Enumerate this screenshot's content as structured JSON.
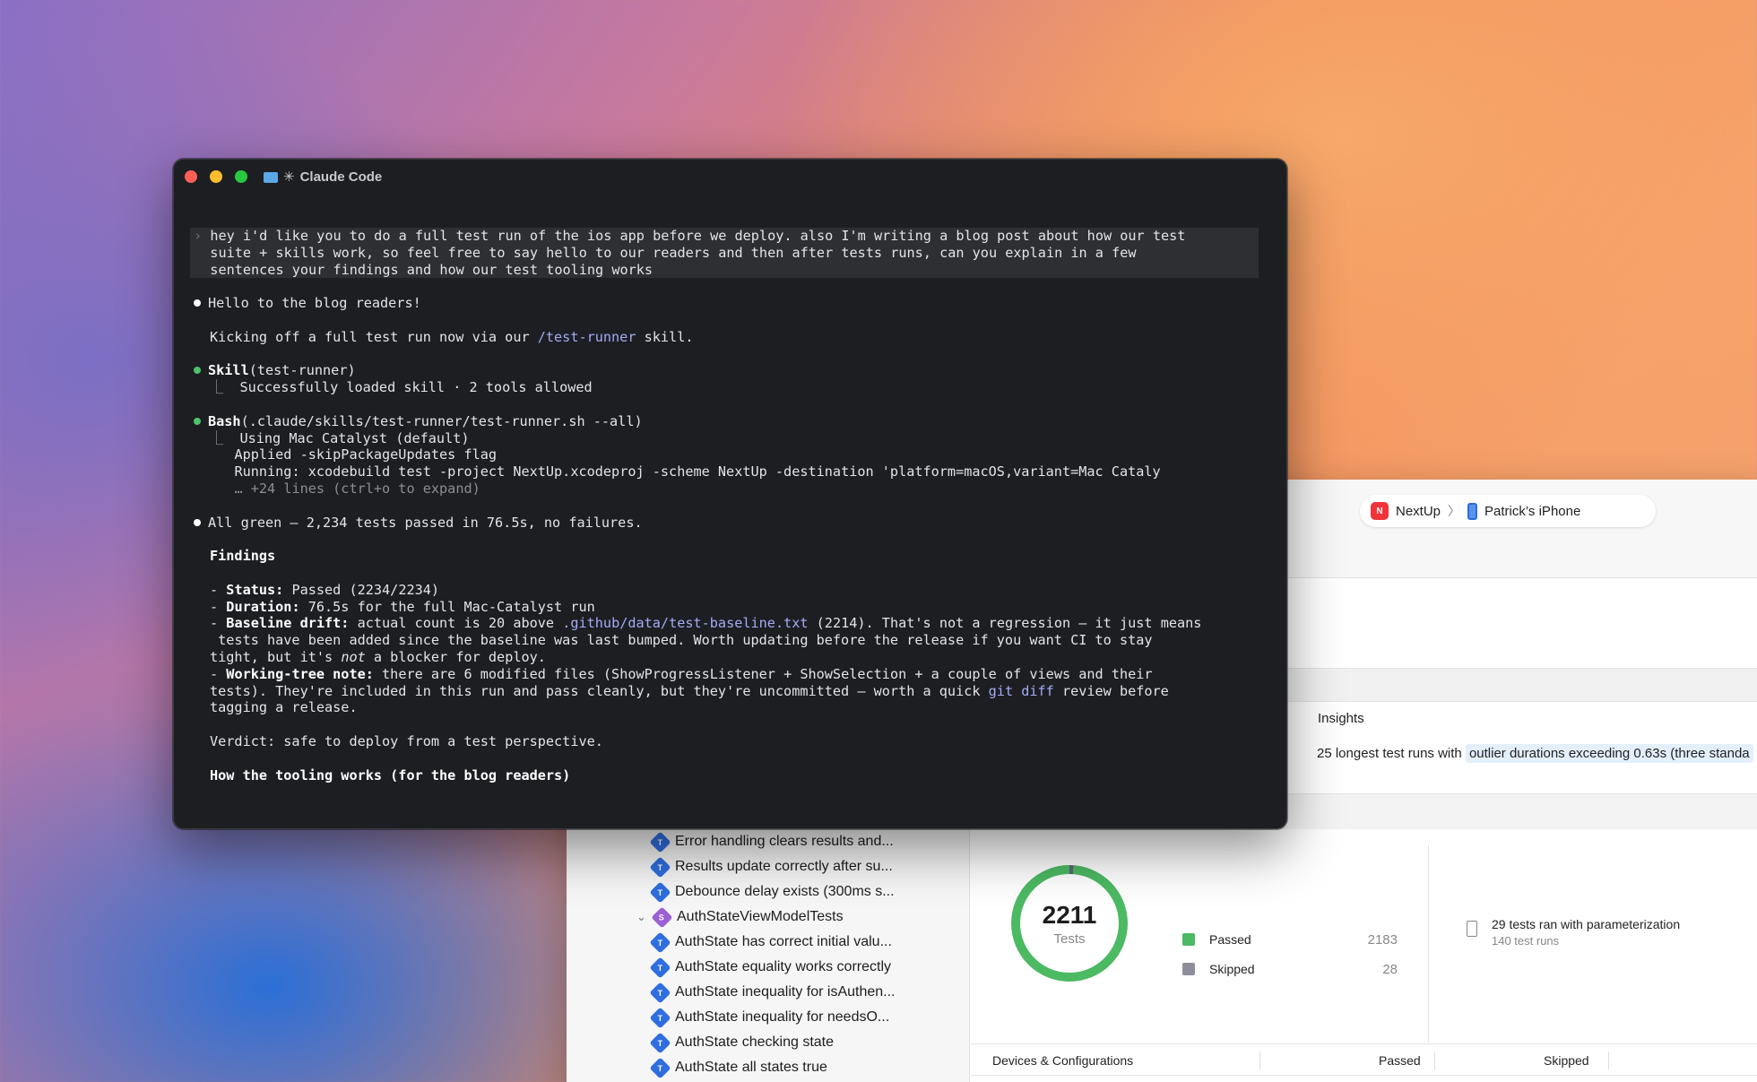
{
  "xcode": {
    "scheme": {
      "app_icon_label": "N",
      "app": "NextUp",
      "separator": "〉",
      "device": "Patrick’s iPhone"
    },
    "insights": {
      "label": "Insights",
      "text_prefix": "25 longest test runs with",
      "text_highlight": "outlier durations exceeding 0.63s (three standa"
    },
    "sidebar": {
      "items": [
        {
          "badge": "T",
          "label": "Error handling clears results and..."
        },
        {
          "badge": "T",
          "label": "Results update correctly after su..."
        },
        {
          "badge": "T",
          "label": "Debounce delay exists (300ms s..."
        },
        {
          "badge": "S",
          "label": "AuthStateViewModelTests",
          "disclosure": "⌄"
        },
        {
          "badge": "T",
          "label": "AuthState has correct initial valu..."
        },
        {
          "badge": "T",
          "label": "AuthState equality works correctly"
        },
        {
          "badge": "T",
          "label": "AuthState inequality for isAuthen..."
        },
        {
          "badge": "T",
          "label": "AuthState inequality for needsO..."
        },
        {
          "badge": "T",
          "label": "AuthState checking state"
        },
        {
          "badge": "T",
          "label": "AuthState all states true"
        }
      ]
    },
    "summary": {
      "total": "2211",
      "total_label": "Tests",
      "passed_label": "Passed",
      "passed_value": "2183",
      "skipped_label": "Skipped",
      "skipped_value": "28",
      "passed_color": "#4cb963",
      "skipped_color": "#8e8e9a",
      "param_title": "29 tests ran with parameterization",
      "param_sub": "140 test runs"
    },
    "table": {
      "col_devices": "Devices & Configurations",
      "col_passed": "Passed",
      "col_skipped": "Skipped"
    }
  },
  "terminal": {
    "title": "Claude Code",
    "title_glyph": "✳",
    "prompt": {
      "caret": "›",
      "lines": [
        "hey i'd like you to do a full test run of the ios app before we deploy. also I'm writing a blog post about how our test",
        "suite + skills work, so feel free to say hello to our readers and then after tests runs, can you explain in a few",
        "sentences your findings and how our test tooling works"
      ]
    },
    "hello": "Hello to the blog readers!",
    "kickoff_pre": "Kicking off a full test run now via our ",
    "kickoff_link": "/test-runner",
    "kickoff_post": " skill.",
    "skill_name": "Skill",
    "skill_arg": "(test-runner)",
    "skill_result": "Successfully loaded skill · 2 tools allowed",
    "bash_name": "Bash",
    "bash_arg": "(.claude/skills/test-runner/test-runner.sh --all)",
    "bash_out": [
      "Using Mac Catalyst (default)",
      "Applied -skipPackageUpdates flag",
      "Running: xcodebuild test -project NextUp.xcodeproj -scheme NextUp -destination 'platform=macOS,variant=Mac Cataly"
    ],
    "bash_more": "… +24 lines (ctrl+o to expand)",
    "tree_glyph": "⎿",
    "all_green": "All green — 2,234 tests passed in 76.5s, no failures.",
    "findings_heading": "Findings",
    "status_label": "Status:",
    "status_text": " Passed (2234/2234)",
    "duration_label": "Duration:",
    "duration_text": " 76.5s for the full Mac-Catalyst run",
    "drift_label": "Baseline drift:",
    "drift_pre": " actual count is 20 above ",
    "drift_link": ".github/data/test-baseline.txt",
    "drift_post": " (2214). That's not a regression — it just means",
    "drift_l2": " tests have been added since the baseline was last bumped. Worth updating before the release if you want CI to stay",
    "drift_l3_pre": "tight, but it's ",
    "drift_l3_em": "not",
    "drift_l3_post": " a blocker for deploy.",
    "wt_label": "Working-tree note:",
    "wt_text": " there are 6 modified files (ShowProgressListener + ShowSelection + a couple of views and their",
    "wt_l2_pre": "tests). They're included in this run and pass cleanly, but they're uncommitted — worth a quick ",
    "wt_l2_link": "git diff",
    "wt_l2_post": " review before",
    "wt_l3": "tagging a release.",
    "verdict": "Verdict: safe to deploy from a test perspective.",
    "tooling_heading": "How the tooling works (for the blog readers)"
  }
}
